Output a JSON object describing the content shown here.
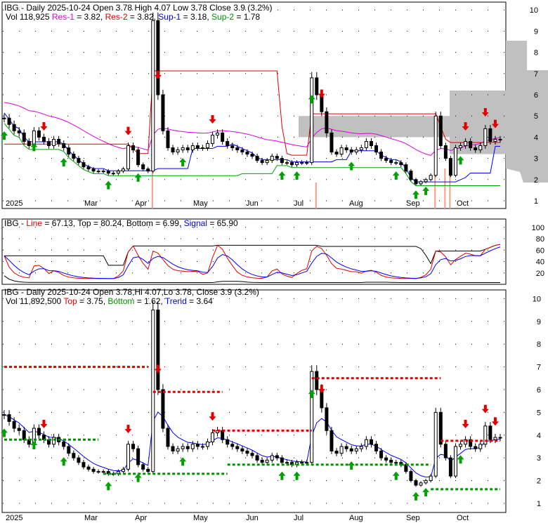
{
  "chart_data": [
    {
      "type": "candlestick",
      "panel": "price",
      "title": "IBG - Daily 2025-10-24 Open 3.78  High 4.07  Low 3.78  Close 3.9 (3.2%)",
      "legend": {
        "vol": "Vol 118,925",
        "res1": "Res-1",
        "res1_val": " = 3.82, ",
        "res2": "Res-2",
        "res2_val": " = 3.82, ",
        "sup1": "Sup-1",
        "sup1_val": " = 3.18, ",
        "sup2": "Sup-2",
        "sup2_val": " = 1.78"
      },
      "ylim": [
        1,
        10
      ],
      "yticks": [
        1,
        2,
        3,
        4,
        5,
        6,
        7,
        8,
        9,
        10
      ]
    },
    {
      "type": "line",
      "panel": "oscillator",
      "legend": {
        "prefix": "IBG - ",
        "line": "Line",
        "line_val": " = 67.13, Top = 80.24, Bottom = 6.99, ",
        "signal": "Signal",
        "signal_val": " = 65.90"
      },
      "ylim": [
        0,
        100
      ],
      "yticks": [
        20,
        40,
        60,
        80,
        100
      ]
    },
    {
      "type": "candlestick",
      "panel": "trend",
      "title": "IBG - Daily 2025-10-24 Open 3.78,Hi 4.07,Lo 3.78, Close 3.9 (3.2%)",
      "legend": {
        "vol": "Vol 11,892,500 ",
        "top": "Top",
        "top_val": " = 3.75, ",
        "bottom": "Bottom",
        "bottom_val": " = 1.62, ",
        "trend": "Trend",
        "trend_val": " = 3.64"
      },
      "ylim": [
        1,
        10
      ],
      "yticks": [
        1,
        2,
        3,
        4,
        5,
        6,
        7,
        8,
        9,
        10
      ]
    }
  ],
  "x_labels": [
    "2025",
    "Mar",
    "Apr",
    "May",
    "Jun",
    "Jul",
    "Aug",
    "Sep",
    "Oct"
  ],
  "closes": [
    4.9,
    4.6,
    4.3,
    4.2,
    3.8,
    3.6,
    4.3,
    4.0,
    3.8,
    3.6,
    3.9,
    3.7,
    3.5,
    3.2,
    3.0,
    2.8,
    2.6,
    2.5,
    2.4,
    2.4,
    2.4,
    2.3,
    2.3,
    2.4,
    2.5,
    3.6,
    3.4,
    2.7,
    2.5,
    2.4,
    9.5,
    6.0,
    4.3,
    3.5,
    3.3,
    3.4,
    3.5,
    3.4,
    3.6,
    3.5,
    3.5,
    3.7,
    4.1,
    4.2,
    3.8,
    3.6,
    3.5,
    3.4,
    3.3,
    3.2,
    3.1,
    2.9,
    2.8,
    2.9,
    3.1,
    3.0,
    2.8,
    2.8,
    2.7,
    2.8,
    2.8,
    2.8,
    6.8,
    6.0,
    5.2,
    4.2,
    3.3,
    3.2,
    3.5,
    3.4,
    3.3,
    3.4,
    3.5,
    3.8,
    3.6,
    3.3,
    3.0,
    2.9,
    2.8,
    2.8,
    2.7,
    2.4,
    2.0,
    1.8,
    1.9,
    2.0,
    2.2,
    5.0,
    3.6,
    3.0,
    2.2,
    3.5,
    3.6,
    3.8,
    3.5,
    3.4,
    3.6,
    4.4,
    3.8,
    3.9,
    3.9
  ],
  "res_levels": [
    {
      "from": 0,
      "to": 29,
      "v": 7.0
    },
    {
      "from": 30,
      "to": 44,
      "v": 5.9
    },
    {
      "from": 42,
      "to": 62,
      "v": 4.2
    },
    {
      "from": 62,
      "to": 88,
      "v": 6.5
    },
    {
      "from": 88,
      "to": 100,
      "v": 3.75
    }
  ],
  "sup_levels": [
    {
      "from": 0,
      "to": 19,
      "v": 3.8
    },
    {
      "from": 20,
      "to": 45,
      "v": 2.3
    },
    {
      "from": 45,
      "to": 80,
      "v": 2.7
    },
    {
      "from": 80,
      "to": 86,
      "v": 2.7
    },
    {
      "from": 86,
      "to": 100,
      "v": 1.62
    }
  ],
  "up_arrows": [
    0,
    6,
    12,
    21,
    27,
    36,
    56,
    59,
    62,
    70,
    79,
    83,
    85,
    92
  ],
  "down_arrows": [
    8,
    25,
    31,
    42,
    64,
    93,
    97,
    99
  ]
}
